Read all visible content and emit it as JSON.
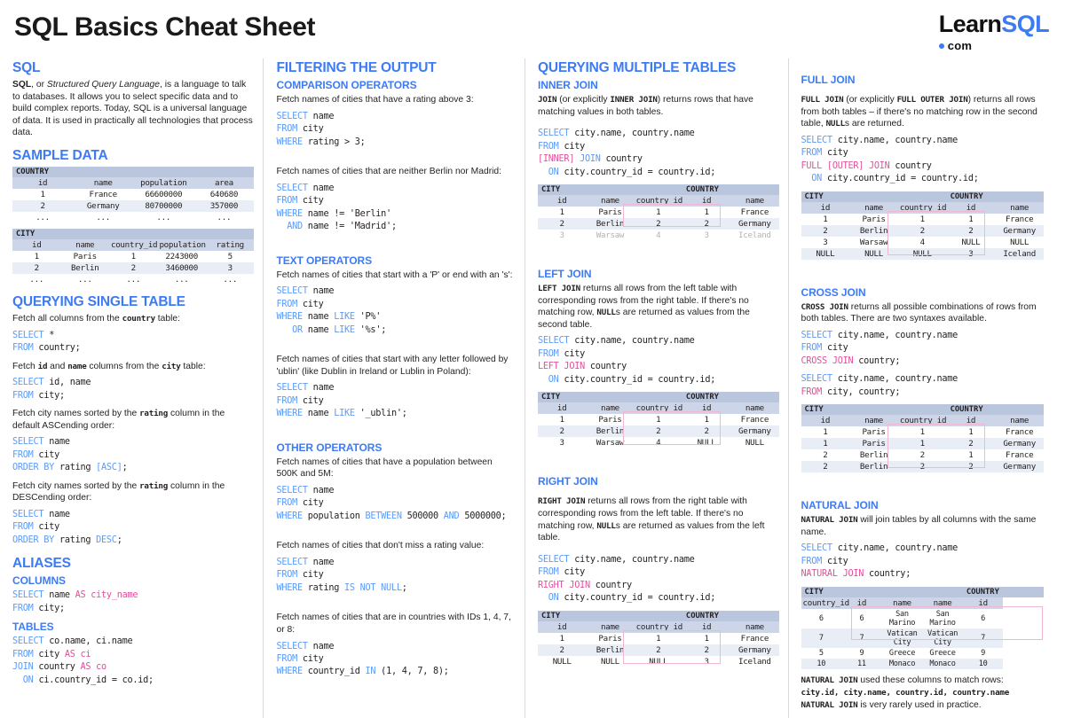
{
  "header": {
    "title": "SQL Basics Cheat Sheet",
    "logo_learn": "Learn",
    "logo_sql": "SQL",
    "logo_sub": "com"
  },
  "colors": {
    "accent": "#3d7bf5",
    "keyword": "#5b9bf8",
    "keyword2": "#e0519b",
    "table_title_bg": "#b9c6dd",
    "table_head_bg": "#ccd6e8",
    "table_row_alt": "#e8edf6",
    "highlight_border": "#eeb8d2"
  },
  "col1": {
    "sql_heading": "SQL",
    "sql_desc_1": "SQL",
    "sql_desc_2": ", or ",
    "sql_desc_3": "Structured Query Language",
    "sql_desc_4": ", is a language to talk to databases. It allows you to select specific data and to build complex reports. Today, SQL is a universal language of data. It is used in practically all technologies that process data.",
    "sample_heading": "SAMPLE DATA",
    "country_table": {
      "name": "COUNTRY",
      "columns": [
        "id",
        "name",
        "population",
        "area"
      ],
      "rows": [
        [
          "1",
          "France",
          "66600000",
          "640680"
        ],
        [
          "2",
          "Germany",
          "80700000",
          "357000"
        ],
        [
          "...",
          "...",
          "...",
          "..."
        ]
      ]
    },
    "city_table": {
      "name": "CITY",
      "columns": [
        "id",
        "name",
        "country_id",
        "population",
        "rating"
      ],
      "rows": [
        [
          "1",
          "Paris",
          "1",
          "2243000",
          "5"
        ],
        [
          "2",
          "Berlin",
          "2",
          "3460000",
          "3"
        ],
        [
          "...",
          "...",
          "...",
          "...",
          "..."
        ]
      ]
    },
    "querying_heading": "QUERYING SINGLE TABLE",
    "q1_desc_a": "Fetch all columns from the ",
    "q1_desc_code": "country",
    "q1_desc_b": " table:",
    "q1_code": "SELECT *\nFROM country;",
    "q2_desc_a": "Fetch ",
    "q2_desc_code1": "id",
    "q2_desc_mid": " and ",
    "q2_desc_code2": "name",
    "q2_desc_b": " columns from the ",
    "q2_desc_code3": "city",
    "q2_desc_c": " table:",
    "q2_code": "SELECT id, name\nFROM city;",
    "q3_desc_a": "Fetch city names sorted by the ",
    "q3_desc_code": "rating",
    "q3_desc_b": " column in the default ASCending order:",
    "q3_code": "SELECT name\nFROM city\nORDER BY rating [ASC];",
    "q4_desc_a": "Fetch city names sorted by the ",
    "q4_desc_code": "rating",
    "q4_desc_b": " column in the DESCending order:",
    "q4_code": "SELECT name\nFROM city\nORDER BY rating DESC;",
    "aliases_heading": "ALIASES",
    "columns_sub": "COLUMNS",
    "columns_code": "SELECT name AS city_name\nFROM city;",
    "tables_sub": "TABLES",
    "tables_code": "SELECT co.name, ci.name\nFROM city AS ci\nJOIN country AS co\n  ON ci.country_id = co.id;"
  },
  "col2": {
    "filtering_heading": "FILTERING THE OUTPUT",
    "comparison_sub": "COMPARISON OPERATORS",
    "c1_desc": "Fetch names of cities that have a rating above 3:",
    "c1_code": "SELECT name\nFROM city\nWHERE rating > 3;",
    "c2_desc": "Fetch names of cities that are neither Berlin nor Madrid:",
    "c2_code": "SELECT name\nFROM city\nWHERE name != 'Berlin'\n  AND name != 'Madrid';",
    "text_sub": "TEXT OPERATORS",
    "t1_desc": "Fetch names of cities that start with a 'P' or end with an 's':",
    "t1_code": "SELECT name\nFROM city\nWHERE name LIKE 'P%'\n   OR name LIKE '%s';",
    "t2_desc": "Fetch names of cities that start with any letter followed by 'ublin' (like Dublin in Ireland or Lublin in Poland):",
    "t2_code": "SELECT name\nFROM city\nWHERE name LIKE '_ublin';",
    "other_sub": "OTHER OPERATORS",
    "o1_desc": "Fetch names of cities that have a population between 500K and 5M:",
    "o1_code": "SELECT name\nFROM city\nWHERE population BETWEEN 500000 AND 5000000;",
    "o2_desc": "Fetch names of cities that don't miss a rating value:",
    "o2_code": "SELECT name\nFROM city\nWHERE rating IS NOT NULL;",
    "o3_desc": "Fetch names of cities that are in countries with IDs 1, 4, 7, or 8:",
    "o3_code": "SELECT name\nFROM city\nWHERE country_id IN (1, 4, 7, 8);"
  },
  "col3": {
    "querying_heading": "QUERYING MULTIPLE TABLES",
    "inner_sub": "INNER JOIN",
    "inner_desc_c1": "JOIN",
    "inner_desc_a": " (or explicitly ",
    "inner_desc_c2": "INNER JOIN",
    "inner_desc_b": ") returns rows that have matching values in both tables.",
    "inner_code": "SELECT city.name, country.name\nFROM city\n[INNER] JOIN country\n  ON city.country_id = country.id;",
    "inner_table": {
      "left_name": "CITY",
      "right_name": "COUNTRY",
      "columns": [
        "id",
        "name",
        "country_id",
        "id",
        "name"
      ],
      "rows": [
        [
          "1",
          "Paris",
          "1",
          "1",
          "France"
        ],
        [
          "2",
          "Berlin",
          "2",
          "2",
          "Germany"
        ],
        [
          "3",
          "Warsaw",
          "4",
          "3",
          "Iceland"
        ]
      ],
      "dim_rows": [
        2
      ]
    },
    "left_sub": "LEFT JOIN",
    "left_desc_c1": "LEFT JOIN",
    "left_desc_a": " returns all rows from the left table with corresponding rows from the right table. If there's no matching row, ",
    "left_desc_c2": "NULL",
    "left_desc_b": "s are returned as values from the second table.",
    "left_code": "SELECT city.name, country.name\nFROM city\nLEFT JOIN country\n  ON city.country_id = country.id;",
    "left_table": {
      "left_name": "CITY",
      "right_name": "COUNTRY",
      "columns": [
        "id",
        "name",
        "country_id",
        "id",
        "name"
      ],
      "rows": [
        [
          "1",
          "Paris",
          "1",
          "1",
          "France"
        ],
        [
          "2",
          "Berlin",
          "2",
          "2",
          "Germany"
        ],
        [
          "3",
          "Warsaw",
          "4",
          "NULL",
          "NULL"
        ]
      ],
      "dim_rows": []
    },
    "right_sub": "RIGHT JOIN",
    "right_desc_c1": "RIGHT JOIN",
    "right_desc_a": " returns all rows from the right table with corresponding rows from the left table. If there's no matching row, ",
    "right_desc_c2": "NULL",
    "right_desc_b": "s are returned as values from the left table.",
    "right_code": "SELECT city.name, country.name\nFROM city\nRIGHT JOIN country\n  ON city.country_id = country.id;",
    "right_table": {
      "left_name": "CITY",
      "right_name": "COUNTRY",
      "columns": [
        "id",
        "name",
        "country_id",
        "id",
        "name"
      ],
      "rows": [
        [
          "1",
          "Paris",
          "1",
          "1",
          "France"
        ],
        [
          "2",
          "Berlin",
          "2",
          "2",
          "Germany"
        ],
        [
          "NULL",
          "NULL",
          "NULL",
          "3",
          "Iceland"
        ]
      ],
      "dim_rows": []
    }
  },
  "col4": {
    "full_sub": "FULL JOIN",
    "full_desc_c1": "FULL JOIN",
    "full_desc_a": " (or explicitly ",
    "full_desc_c2": "FULL OUTER JOIN",
    "full_desc_b": ") returns all rows from both tables – if there's no matching row in the second table, ",
    "full_desc_c3": "NULL",
    "full_desc_c": "s are returned.",
    "full_code": "SELECT city.name, country.name\nFROM city\nFULL [OUTER] JOIN country\n  ON city.country_id = country.id;",
    "full_table": {
      "left_name": "CITY",
      "right_name": "COUNTRY",
      "columns": [
        "id",
        "name",
        "country_id",
        "id",
        "name"
      ],
      "rows": [
        [
          "1",
          "Paris",
          "1",
          "1",
          "France"
        ],
        [
          "2",
          "Berlin",
          "2",
          "2",
          "Germany"
        ],
        [
          "3",
          "Warsaw",
          "4",
          "NULL",
          "NULL"
        ],
        [
          "NULL",
          "NULL",
          "NULL",
          "3",
          "Iceland"
        ]
      ]
    },
    "cross_sub": "CROSS JOIN",
    "cross_desc_c1": "CROSS JOIN",
    "cross_desc_a": " returns all possible combinations of rows from both tables. There are two syntaxes available.",
    "cross_code_1": "SELECT city.name, country.name\nFROM city\nCROSS JOIN country;",
    "cross_code_2": "SELECT city.name, country.name\nFROM city, country;",
    "cross_table": {
      "left_name": "CITY",
      "right_name": "COUNTRY",
      "columns": [
        "id",
        "name",
        "country_id",
        "id",
        "name"
      ],
      "rows": [
        [
          "1",
          "Paris",
          "1",
          "1",
          "France"
        ],
        [
          "1",
          "Paris",
          "1",
          "2",
          "Germany"
        ],
        [
          "2",
          "Berlin",
          "2",
          "1",
          "France"
        ],
        [
          "2",
          "Berlin",
          "2",
          "2",
          "Germany"
        ]
      ]
    },
    "natural_sub": "NATURAL JOIN",
    "natural_desc_c1": "NATURAL JOIN",
    "natural_desc_a": " will join tables by all columns with the same name.",
    "natural_code": "SELECT city.name, country.name\nFROM city\nNATURAL JOIN country;",
    "natural_table": {
      "left_name": "CITY",
      "right_name": "COUNTRY",
      "columns": [
        "country_id",
        "id",
        "name",
        "name",
        "id"
      ],
      "rows": [
        [
          "6",
          "6",
          "San Marino",
          "San Marino",
          "6"
        ],
        [
          "7",
          "7",
          "Vatican City",
          "Vatican City",
          "7"
        ],
        [
          "5",
          "9",
          "Greece",
          "Greece",
          "9"
        ],
        [
          "10",
          "11",
          "Monaco",
          "Monaco",
          "10"
        ]
      ]
    },
    "natural_note_1": "NATURAL JOIN",
    "natural_note_1b": " used these columns to match rows:",
    "natural_note_2": "city.id, city.name, country.id, country.name",
    "natural_note_3": "NATURAL JOIN",
    "natural_note_3b": " is very rarely used in practice."
  }
}
